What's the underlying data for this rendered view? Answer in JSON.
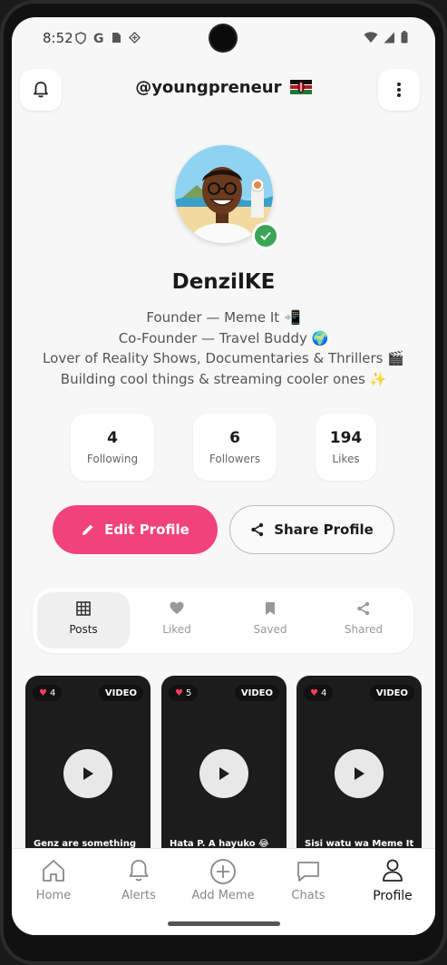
{
  "status_bar": {
    "time": "8:52"
  },
  "header": {
    "username": "@youngpreneur",
    "flag_icon": "kenya-flag-icon"
  },
  "profile": {
    "display_name": "DenzilKE",
    "bio_lines": [
      "Founder — Meme It 📲",
      "Co-Founder — Travel Buddy 🌍",
      "Lover of Reality Shows, Documentaries & Thrillers 🎬",
      "Building cool things & streaming cooler ones ✨"
    ]
  },
  "stats": [
    {
      "value": "4",
      "label": "Following"
    },
    {
      "value": "6",
      "label": "Followers"
    },
    {
      "value": "194",
      "label": "Likes"
    }
  ],
  "actions": {
    "edit_label": "Edit Profile",
    "share_label": "Share Profile"
  },
  "tabs": [
    {
      "label": "Posts",
      "icon": "grid-icon",
      "active": true
    },
    {
      "label": "Liked",
      "icon": "heart-icon",
      "active": false
    },
    {
      "label": "Saved",
      "icon": "bookmark-icon",
      "active": false
    },
    {
      "label": "Shared",
      "icon": "share-icon",
      "active": false
    }
  ],
  "posts": [
    {
      "likes": "4",
      "badge": "VIDEO",
      "caption": "Genz are something"
    },
    {
      "likes": "5",
      "badge": "VIDEO",
      "caption": "Hata P. A hayuko 😂"
    },
    {
      "likes": "4",
      "badge": "VIDEO",
      "caption": "Sisi watu wa Meme It"
    }
  ],
  "nav": [
    {
      "label": "Home",
      "icon": "home-icon"
    },
    {
      "label": "Alerts",
      "icon": "bell-icon"
    },
    {
      "label": "Add Meme",
      "icon": "plus-circle-icon"
    },
    {
      "label": "Chats",
      "icon": "chat-icon"
    },
    {
      "label": "Profile",
      "icon": "person-icon",
      "active": true
    }
  ],
  "colors": {
    "accent": "#f2427a",
    "verified": "#3aa655",
    "card_bg": "#1c1c1c"
  }
}
